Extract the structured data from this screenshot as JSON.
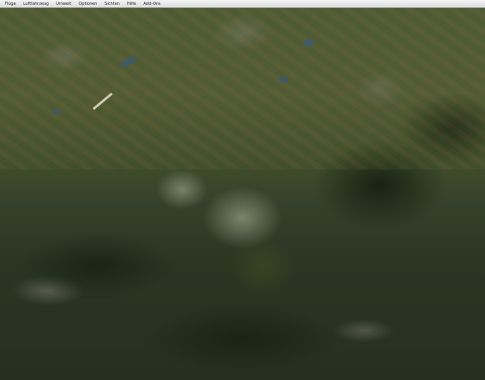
{
  "menubar": {
    "items": [
      "Flüge",
      "Luftfahrzeug",
      "Umwelt",
      "Optionen",
      "Sichten",
      "Hilfe",
      "Add-Ons"
    ]
  },
  "overlay": {
    "status_line": "",
    "info_lines": [
      "",
      "",
      ""
    ]
  },
  "colors": {
    "overlay_text": "#ff2a2a",
    "menubar_bg": "#e6e6e6"
  }
}
